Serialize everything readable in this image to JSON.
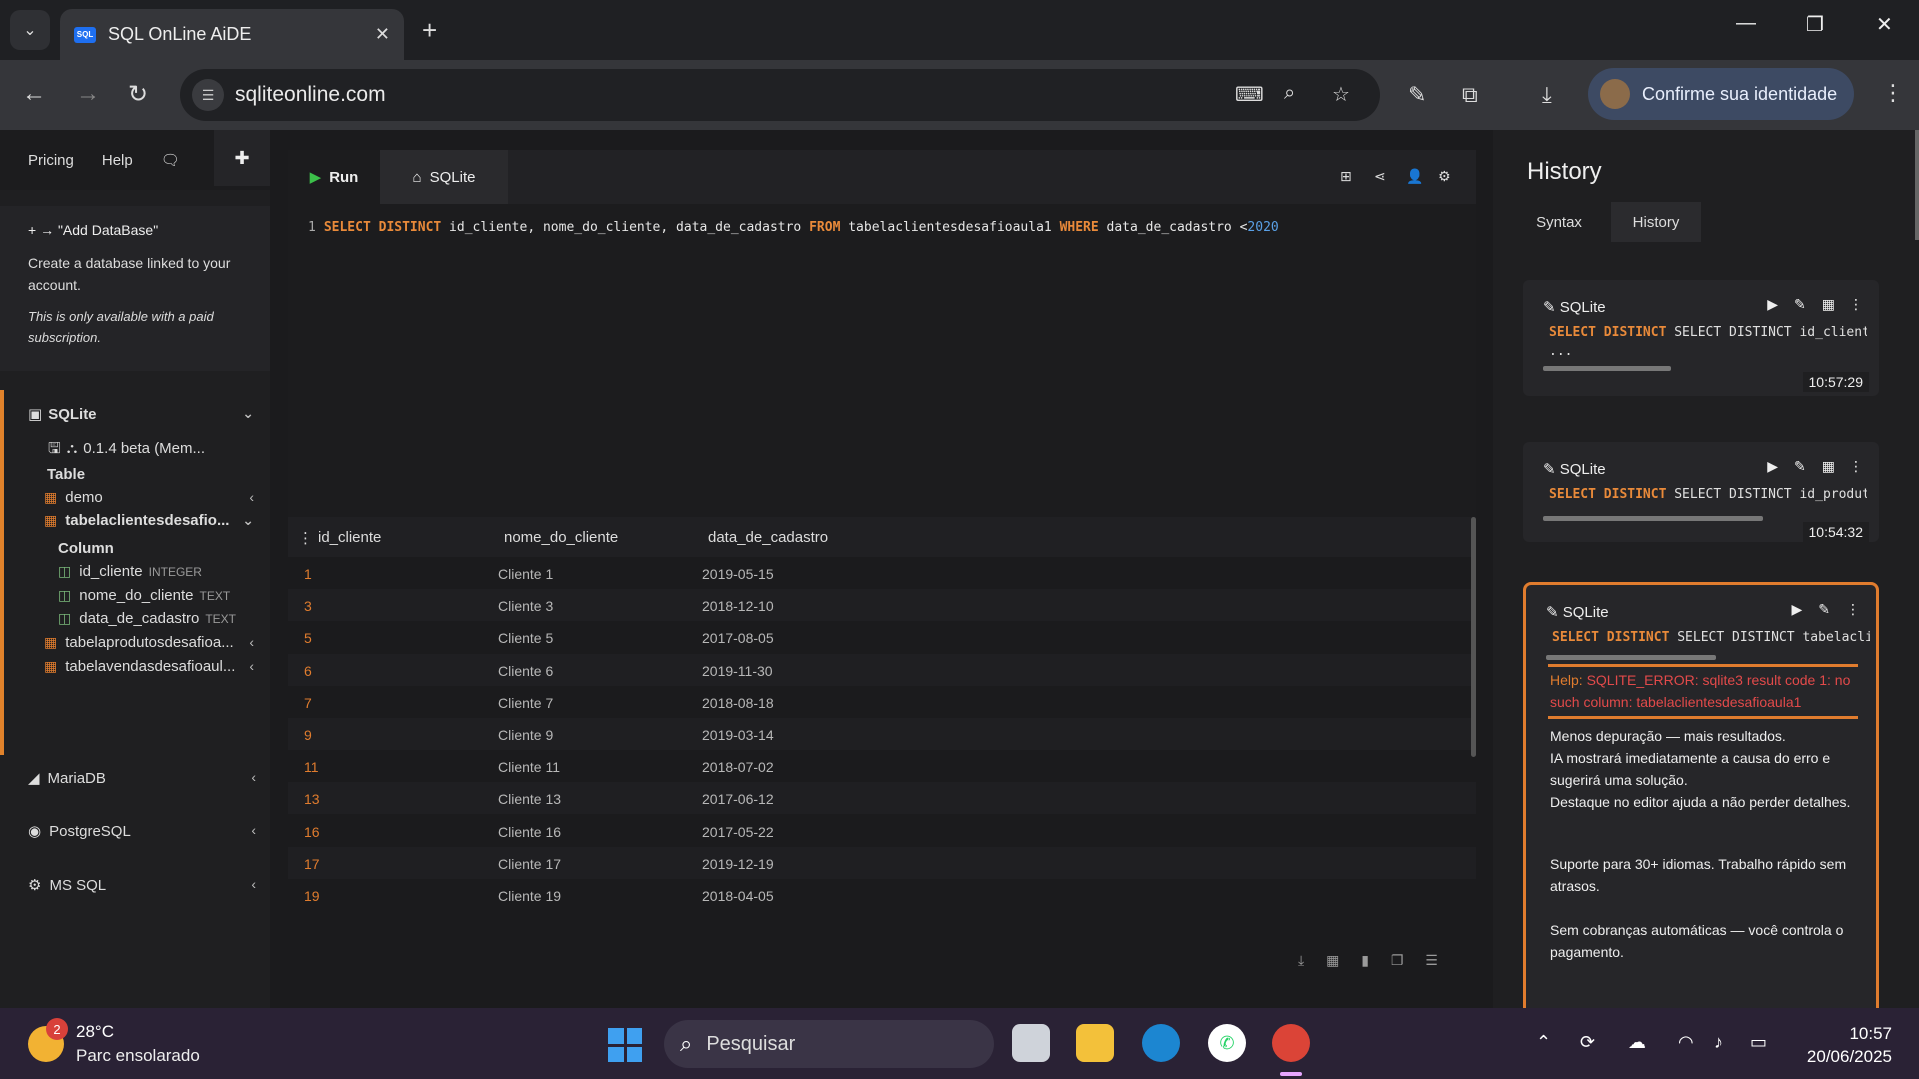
{
  "browser": {
    "tab_title": "SQL OnLine AiDE",
    "tab_favicon": "SQL",
    "url": "sqliteonline.com",
    "profile_label": "Confirme sua identidade"
  },
  "sidebar": {
    "links": [
      "Pricing",
      "Help"
    ],
    "add_db_title": "+ → \"Add DataBase\"",
    "add_db_desc": "Create a database linked to your account.",
    "add_db_note": "This is only available with a paid subscription.",
    "db_name": "SQLite",
    "db_version": "0.1.4 beta (Mem...",
    "table_header": "Table",
    "tables": [
      "demo",
      "tabelaclientesdesafio...",
      "tabelaprodutosdesafioa...",
      "tabelavendasdesafioaul..."
    ],
    "column_header": "Column",
    "columns": [
      {
        "name": "id_cliente",
        "type": "INTEGER"
      },
      {
        "name": "nome_do_cliente",
        "type": "TEXT"
      },
      {
        "name": "data_de_cadastro",
        "type": "TEXT"
      }
    ],
    "other_dbs": [
      "MariaDB",
      "PostgreSQL",
      "MS SQL"
    ]
  },
  "editor": {
    "run_label": "Run",
    "db_tab_label": "SQLite",
    "line_number": "1",
    "code_parts": {
      "k1": "SELECT DISTINCT",
      "t1": " id_cliente, nome_do_cliente, data_de_cadastro ",
      "k2": "FROM",
      "t2": " tabelaclientesdesafioaula1 ",
      "k3": "WHERE",
      "t3": " data_de_cadastro <",
      "n1": "2020"
    }
  },
  "results": {
    "columns": [
      "id_cliente",
      "nome_do_cliente",
      "data_de_cadastro"
    ],
    "rows": [
      [
        "1",
        "Cliente 1",
        "2019-05-15"
      ],
      [
        "3",
        "Cliente 3",
        "2018-12-10"
      ],
      [
        "5",
        "Cliente 5",
        "2017-08-05"
      ],
      [
        "6",
        "Cliente 6",
        "2019-11-30"
      ],
      [
        "7",
        "Cliente 7",
        "2018-08-18"
      ],
      [
        "9",
        "Cliente 9",
        "2019-03-14"
      ],
      [
        "11",
        "Cliente 11",
        "2018-07-02"
      ],
      [
        "13",
        "Cliente 13",
        "2017-06-12"
      ],
      [
        "16",
        "Cliente 16",
        "2017-05-22"
      ],
      [
        "17",
        "Cliente 17",
        "2019-12-19"
      ],
      [
        "19",
        "Cliente 19",
        "2018-04-05"
      ]
    ]
  },
  "history": {
    "title": "History",
    "tabs": [
      "Syntax",
      "History"
    ],
    "entries": [
      {
        "db": "SQLite",
        "sql": "SELECT DISTINCT id_cliente, nome_do_clie",
        "sql2": "...",
        "time": "10:57:29"
      },
      {
        "db": "SQLite",
        "sql": "SELECT DISTINCT id_produto FROM tabelapr",
        "time": "10:54:32"
      },
      {
        "db": "SQLite",
        "sql": "SELECT DISTINCT tabelaclientesdesafioau"
      }
    ],
    "help_label": "Help:",
    "error_text": "SQLITE_ERROR: sqlite3 result code 1: no such column: tabelaclientesdesafioaula1",
    "promo_1": "Menos depuração — mais resultados.",
    "promo_2": "IA mostrará imediatamente a causa do erro e sugerirá uma solução.",
    "promo_3": "Destaque no editor ajuda a não perder detalhes.",
    "promo_4": "Suporte para 30+ idiomas. Trabalho rápido sem atrasos.",
    "promo_5": "Sem cobranças automáticas — você controla o pagamento."
  },
  "taskbar": {
    "weather_badge": "2",
    "temperature": "28°C",
    "weather_desc": "Parc ensolarado",
    "search_placeholder": "Pesquisar",
    "time": "10:57",
    "date": "20/06/2025"
  },
  "colors": {
    "accent": "#e07c2e",
    "keyword": "#e98a3a",
    "number": "#5aa0e6",
    "error": "#e24a4a",
    "run": "#3cbf4a"
  }
}
